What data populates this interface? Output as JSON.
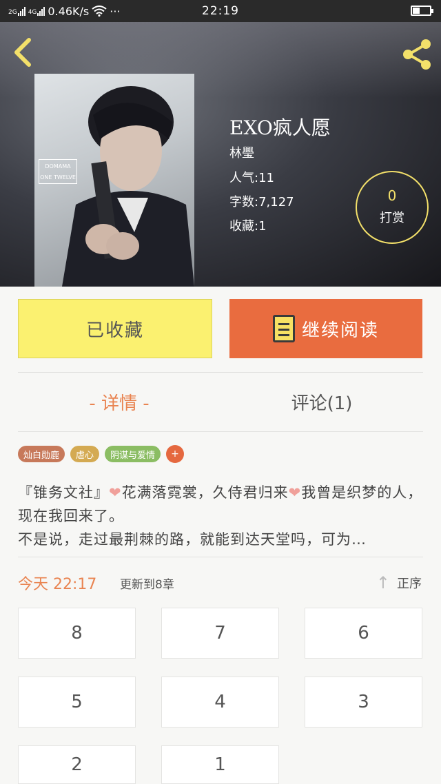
{
  "status_bar": {
    "net_labels": [
      "2G",
      "4G"
    ],
    "speed": "0.46K/s",
    "dots": "···",
    "time": "22:19"
  },
  "header": {
    "back_icon": "chevron-left-icon",
    "share_icon": "share-icon",
    "accent_color": "#f3e06a"
  },
  "book": {
    "cover_tag": "DOMAMA ONE TWELVE",
    "title": "EXO疯人愿",
    "author": "林璺",
    "popularity": "人气:11",
    "word_count": "字数:7,127",
    "favorites": "收藏:1",
    "reward_count": "0",
    "reward_label": "打赏"
  },
  "actions": {
    "collected_label": "已收藏",
    "read_label": "继续阅读",
    "read_color": "#e96c3f",
    "collected_color": "#fbf170"
  },
  "tabs": {
    "detail_label": "- 详情 -",
    "comment_label": "评论(1)"
  },
  "tags": [
    {
      "label": "灿白勋鹿",
      "color": "#c7795a"
    },
    {
      "label": "虐心",
      "color": "#d4aa52"
    },
    {
      "label": "阴谋与爱情",
      "color": "#8bbd63"
    }
  ],
  "tag_add": "+",
  "synopsis": {
    "part1": "『锥务文社』",
    "part2": "花满落霓裳，久侍君归来",
    "part3": "我曾是织梦的人，现在我回来了。",
    "line3": "不是说，走过最荆棘的路，就能到达天堂吗，可为…"
  },
  "updates": {
    "time": "今天 22:17",
    "text": "更新到8章",
    "sort_label": "正序"
  },
  "chapters": [
    "8",
    "7",
    "6",
    "5",
    "4",
    "3",
    "2",
    "1"
  ]
}
